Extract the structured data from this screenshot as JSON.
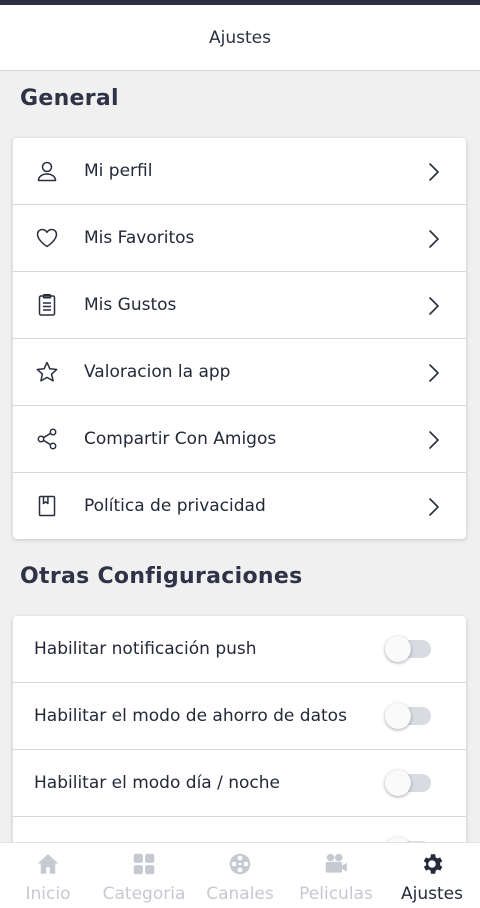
{
  "header": {
    "title": "Ajustes"
  },
  "general": {
    "title": "General",
    "items": [
      {
        "label": "Mi perfil",
        "icon": "user-icon"
      },
      {
        "label": "Mis Favoritos",
        "icon": "heart-icon"
      },
      {
        "label": "Mis Gustos",
        "icon": "clipboard-icon"
      },
      {
        "label": "Valoracion la app",
        "icon": "star-icon"
      },
      {
        "label": "Compartir Con Amigos",
        "icon": "share-icon"
      },
      {
        "label": "Política de privacidad",
        "icon": "book-icon"
      }
    ]
  },
  "otras": {
    "title": "Otras Configuraciones",
    "toggles": [
      {
        "label": "Habilitar notificación push",
        "enabled": false
      },
      {
        "label": "Habilitar el modo de ahorro de datos",
        "enabled": false
      },
      {
        "label": "Habilitar el modo día / noche",
        "enabled": false
      },
      {
        "label": "",
        "enabled": false
      }
    ]
  },
  "nav": {
    "items": [
      {
        "label": "Inicio",
        "icon": "home-icon",
        "active": false
      },
      {
        "label": "Categoria",
        "icon": "grid-icon",
        "active": false
      },
      {
        "label": "Canales",
        "icon": "film-reel-icon",
        "active": false
      },
      {
        "label": "Peliculas",
        "icon": "video-camera-icon",
        "active": false
      },
      {
        "label": "Ajustes",
        "icon": "gear-icon",
        "active": true
      }
    ]
  },
  "colors": {
    "text": "#242838",
    "inactive_nav": "#c7c9d1",
    "active_nav": "#262a3a",
    "toggle_track": "#d9dbe3"
  }
}
